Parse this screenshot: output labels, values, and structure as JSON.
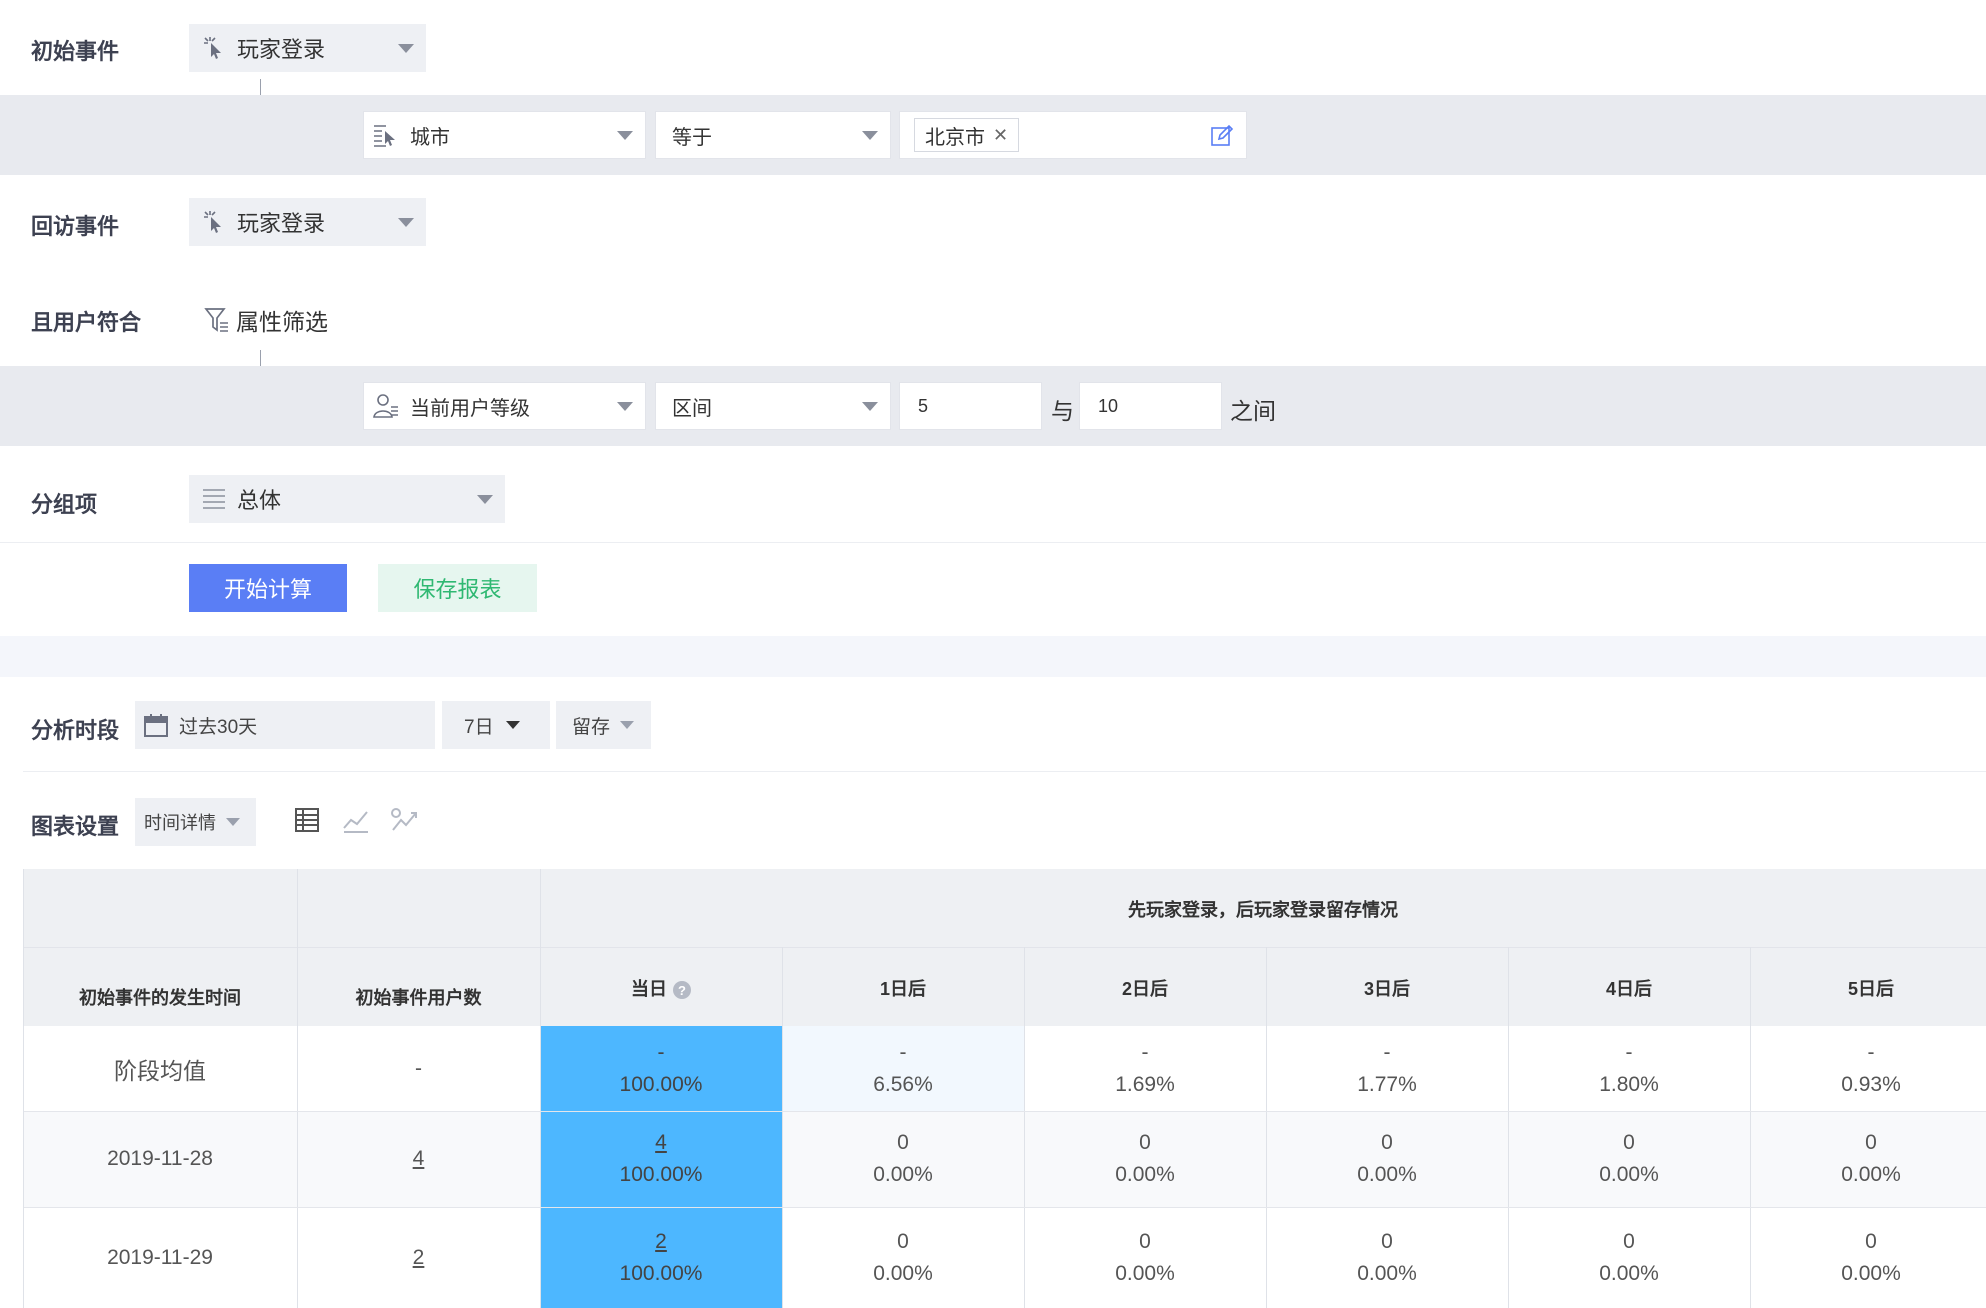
{
  "filters": {
    "initial_event": {
      "label": "初始事件",
      "value": "玩家登录"
    },
    "initial_condition": {
      "property": "城市",
      "operator": "等于",
      "tag": "北京市"
    },
    "return_event": {
      "label": "回访事件",
      "value": "玩家登录"
    },
    "user_match": {
      "label": "且用户符合",
      "filter_link": "属性筛选"
    },
    "user_condition": {
      "property": "当前用户等级",
      "operator": "区间",
      "min": "5",
      "and_text": "与",
      "max": "10",
      "between_text": "之间"
    },
    "group_by": {
      "label": "分组项",
      "value": "总体"
    },
    "start_button": "开始计算",
    "save_button": "保存报表"
  },
  "analysis": {
    "period_label": "分析时段",
    "date_range": "过去30天",
    "days": "7日",
    "metric": "留存",
    "chart_settings_label": "图表设置",
    "chart_mode": "时间详情"
  },
  "table": {
    "group_header": "先玩家登录，后玩家登录留存情况",
    "col_time": "初始事件的发生时间",
    "col_users": "初始事件用户数",
    "day_headers": [
      "当日",
      "1日后",
      "2日后",
      "3日后",
      "4日后",
      "5日后"
    ],
    "rows": [
      {
        "time": "阶段均值",
        "users": "-",
        "cells": [
          {
            "n": "-",
            "p": "100.00%"
          },
          {
            "n": "-",
            "p": "6.56%"
          },
          {
            "n": "-",
            "p": "1.69%"
          },
          {
            "n": "-",
            "p": "1.77%"
          },
          {
            "n": "-",
            "p": "1.80%"
          },
          {
            "n": "-",
            "p": "0.93%"
          }
        ]
      },
      {
        "time": "2019-11-28",
        "users": "4",
        "cells": [
          {
            "n": "4",
            "p": "100.00%"
          },
          {
            "n": "0",
            "p": "0.00%"
          },
          {
            "n": "0",
            "p": "0.00%"
          },
          {
            "n": "0",
            "p": "0.00%"
          },
          {
            "n": "0",
            "p": "0.00%"
          },
          {
            "n": "0",
            "p": "0.00%"
          }
        ]
      },
      {
        "time": "2019-11-29",
        "users": "2",
        "cells": [
          {
            "n": "2",
            "p": "100.00%"
          },
          {
            "n": "0",
            "p": "0.00%"
          },
          {
            "n": "0",
            "p": "0.00%"
          },
          {
            "n": "0",
            "p": "0.00%"
          },
          {
            "n": "0",
            "p": "0.00%"
          },
          {
            "n": "0",
            "p": "0.00%"
          }
        ]
      }
    ]
  },
  "colors": {
    "primary": "#5a7ef5",
    "save": "#2fb872",
    "highlight": "#4db7ff"
  }
}
